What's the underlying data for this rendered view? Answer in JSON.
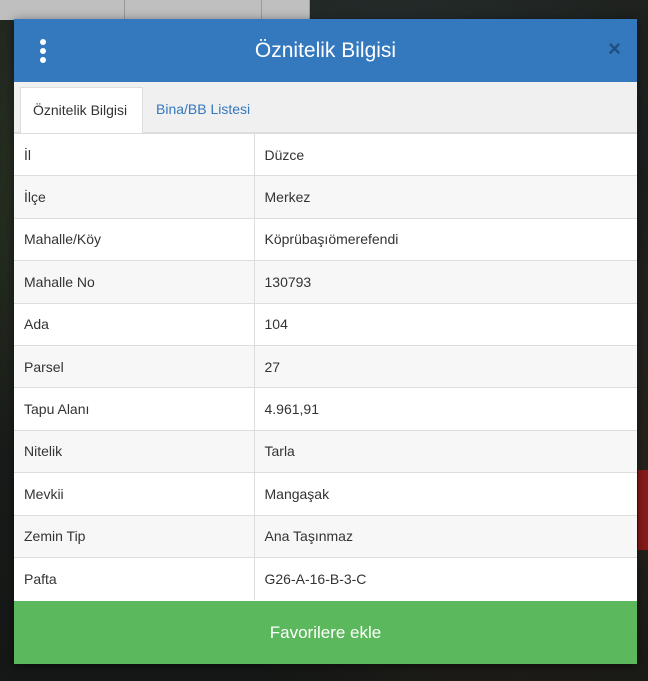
{
  "modal": {
    "title": "Öznitelik Bilgisi",
    "close_symbol": "×",
    "menu_icon": "vertical-dots-icon"
  },
  "tabs": [
    {
      "label": "Öznitelik Bilgisi",
      "active": true
    },
    {
      "label": "Bina/BB Listesi",
      "active": false
    }
  ],
  "rows": [
    {
      "key": "İl",
      "value": "Düzce"
    },
    {
      "key": "İlçe",
      "value": "Merkez"
    },
    {
      "key": "Mahalle/Köy",
      "value": "Köprübaşıömerefendi"
    },
    {
      "key": "Mahalle No",
      "value": "130793"
    },
    {
      "key": "Ada",
      "value": "104"
    },
    {
      "key": "Parsel",
      "value": "27"
    },
    {
      "key": "Tapu Alanı",
      "value": "4.961,91"
    },
    {
      "key": "Nitelik",
      "value": "Tarla"
    },
    {
      "key": "Mevkii",
      "value": "Mangaşak"
    },
    {
      "key": "Zemin Tip",
      "value": "Ana Taşınmaz"
    },
    {
      "key": "Pafta",
      "value": "G26-A-16-B-3-C"
    }
  ],
  "footer": {
    "favorite_label": "Favorilere ekle"
  },
  "colors": {
    "header": "#3478be",
    "button": "#5cb85c",
    "tab_link": "#3478be"
  }
}
